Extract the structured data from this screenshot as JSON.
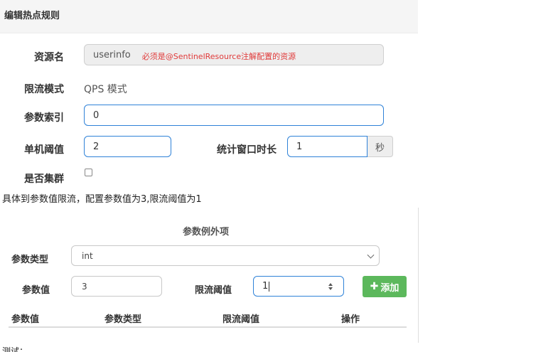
{
  "modal": {
    "title": "编辑热点规则",
    "resource_label": "资源名",
    "resource_value": "userinfo",
    "resource_hint": "必须是@SentinelResource注解配置的资源",
    "limit_mode_label": "限流模式",
    "limit_mode_value": "QPS 模式",
    "param_index_label": "参数索引",
    "param_index_value": "0",
    "threshold_label": "单机阈值",
    "threshold_value": "2",
    "window_label": "统计窗口时长",
    "window_value": "1",
    "window_unit": "秒",
    "cluster_label": "是否集群"
  },
  "caption": "具体到参数值限流，配置参数值为3,限流阈值为1",
  "exception": {
    "title": "参数例外项",
    "param_type_label": "参数类型",
    "param_type_value": "int",
    "param_value_label": "参数值",
    "param_value_value": "3",
    "limit_threshold_label": "限流阈值",
    "limit_threshold_value": "1",
    "add_button": "添加",
    "table_headers": [
      "参数值",
      "参数类型",
      "限流阈值",
      "操作"
    ]
  },
  "footer_caption": "测试："
}
